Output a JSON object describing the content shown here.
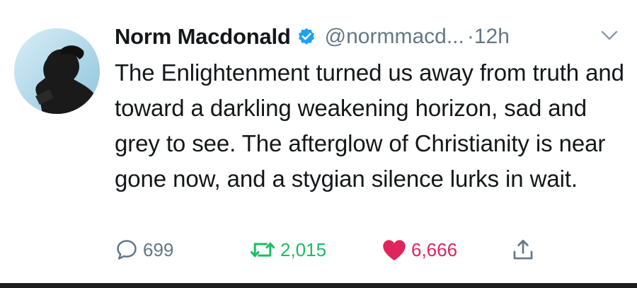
{
  "tweet": {
    "display_name": "Norm Macdonald",
    "handle": "@normmacd...",
    "separator": "·",
    "time": "12h",
    "text": "The Enlightenment turned us away from truth and toward a darkling weakening horizon, sad and grey to see. The afterglow of Christianity is near gone now, and a stygian silence lurks in wait.",
    "replies": "699",
    "retweets": "2,015",
    "likes": "6,666"
  },
  "colors": {
    "verified": "#1da1f2",
    "retweet": "#17bf63",
    "like": "#e0245e",
    "muted": "#657786",
    "text": "#14171a"
  },
  "icons": {
    "reply": "reply-icon",
    "retweet": "retweet-icon",
    "like": "heart-icon",
    "share": "share-icon",
    "verified": "verified-badge-icon",
    "menu": "chevron-down-icon"
  }
}
